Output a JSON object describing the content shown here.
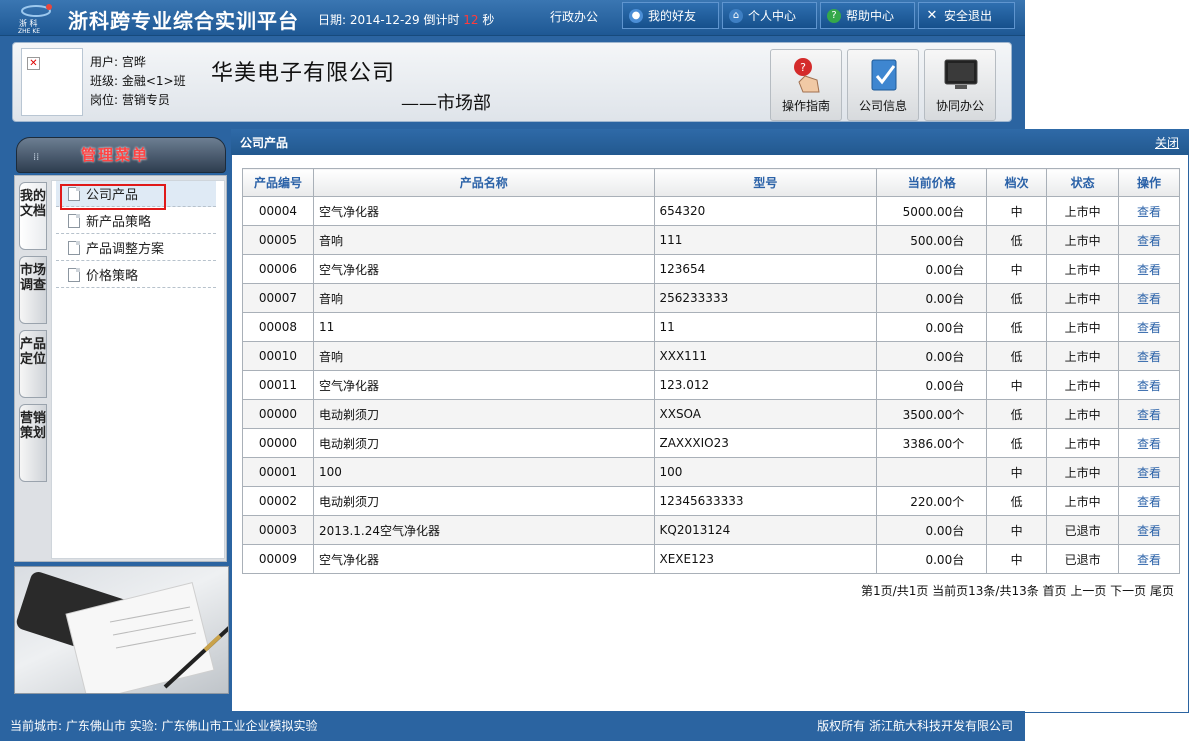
{
  "header": {
    "logo_text": "浙 科",
    "logo_sub": "ZHE KE",
    "title": "浙科跨专业综合实训平台",
    "date_label": "日期:",
    "date": "2014-12-29",
    "countdown_label": "倒计时",
    "countdown": "12",
    "countdown_unit": "秒",
    "admin_link": "行政办公",
    "buttons": [
      "我的好友",
      "个人中心",
      "帮助中心",
      "安全退出"
    ]
  },
  "user": {
    "name": "用户: 宫晔",
    "class": "班级: 金融<1>班",
    "position": "岗位: 营销专员"
  },
  "company": {
    "name": "华美电子有限公司",
    "department": "——市场部"
  },
  "quick_buttons": [
    "操作指南",
    "公司信息",
    "协同办公"
  ],
  "sidebar": {
    "title": "管理菜单",
    "vtabs": [
      "我的文档",
      "市场调查",
      "产品定位",
      "营销策划"
    ],
    "items": [
      "公司产品",
      "新产品策略",
      "产品调整方案",
      "价格策略"
    ]
  },
  "main": {
    "title": "公司产品",
    "close": "关闭",
    "columns": [
      "产品编号",
      "产品名称",
      "型号",
      "当前价格",
      "档次",
      "状态",
      "操作"
    ],
    "rows": [
      [
        "00004",
        "空气净化器",
        "654320",
        "5000.00台",
        "中",
        "上市中",
        "查看"
      ],
      [
        "00005",
        "音响",
        "111",
        "500.00台",
        "低",
        "上市中",
        "查看"
      ],
      [
        "00006",
        "空气净化器",
        "123654",
        "0.00台",
        "中",
        "上市中",
        "查看"
      ],
      [
        "00007",
        "音响",
        "256233333",
        "0.00台",
        "低",
        "上市中",
        "查看"
      ],
      [
        "00008",
        "11",
        "11",
        "0.00台",
        "低",
        "上市中",
        "查看"
      ],
      [
        "00010",
        "音响",
        "XXX111",
        "0.00台",
        "低",
        "上市中",
        "查看"
      ],
      [
        "00011",
        "空气净化器",
        "123.012",
        "0.00台",
        "中",
        "上市中",
        "查看"
      ],
      [
        "00000",
        "电动剃须刀",
        "XXSOA",
        "3500.00个",
        "低",
        "上市中",
        "查看"
      ],
      [
        "00000",
        "电动剃须刀",
        "ZAXXXIO23",
        "3386.00个",
        "低",
        "上市中",
        "查看"
      ],
      [
        "00001",
        "100",
        "100",
        "",
        "中",
        "上市中",
        "查看"
      ],
      [
        "00002",
        "电动剃须刀",
        "12345633333",
        "220.00个",
        "低",
        "上市中",
        "查看"
      ],
      [
        "00003",
        "2013.1.24空气净化器",
        "KQ2013124",
        "0.00台",
        "中",
        "已退市",
        "查看"
      ],
      [
        "00009",
        "空气净化器",
        "XEXE123",
        "0.00台",
        "中",
        "已退市",
        "查看"
      ]
    ],
    "pager": "第1页/共1页 当前页13条/共13条  首页 上一页  下一页 尾页"
  },
  "footer": {
    "left": "当前城市: 广东佛山市   实验: 广东佛山市工业企业模拟实验",
    "right": "版权所有 浙江航大科技开发有限公司"
  },
  "colors": {
    "accent": "#2b64a1",
    "header_text": "#2b62a8",
    "highlight": "#e01919"
  }
}
